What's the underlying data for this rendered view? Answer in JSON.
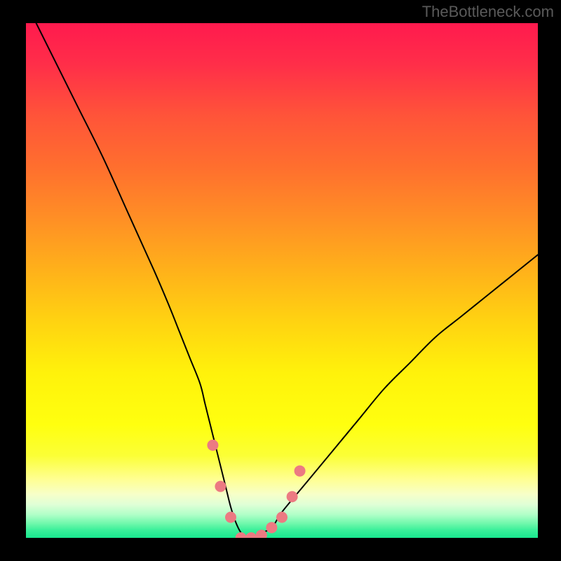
{
  "watermark": "TheBottleneck.com",
  "chart_data": {
    "type": "line",
    "title": "",
    "xlabel": "",
    "ylabel": "",
    "xlim": [
      0,
      100
    ],
    "ylim": [
      0,
      100
    ],
    "grid": false,
    "series": [
      {
        "name": "bottleneck-curve",
        "x": [
          2,
          5,
          10,
          15,
          20,
          25,
          28,
          30,
          32,
          34,
          35,
          36,
          37,
          38,
          39,
          40,
          41,
          42,
          43,
          44,
          45,
          48,
          50,
          55,
          60,
          65,
          70,
          75,
          80,
          85,
          90,
          95,
          100
        ],
        "values": [
          100,
          94,
          84,
          74,
          63,
          52,
          45,
          40,
          35,
          30,
          26,
          22,
          18,
          14,
          10,
          6,
          3,
          1,
          0,
          0,
          0.5,
          2,
          5,
          11,
          17,
          23,
          29,
          34,
          39,
          43,
          47,
          51,
          55
        ]
      }
    ],
    "markers": {
      "name": "highlight-dots",
      "color": "#ec7a82",
      "x": [
        36.5,
        38,
        40,
        42,
        44,
        46,
        48,
        50,
        52,
        53.5
      ],
      "values": [
        18,
        10,
        4,
        0,
        0,
        0.5,
        2,
        4,
        8,
        13
      ]
    },
    "background_gradient": {
      "type": "vertical",
      "stops": [
        {
          "offset": 0.0,
          "color": "#ff1a4e"
        },
        {
          "offset": 0.08,
          "color": "#ff2e49"
        },
        {
          "offset": 0.18,
          "color": "#ff5439"
        },
        {
          "offset": 0.28,
          "color": "#ff6f2e"
        },
        {
          "offset": 0.38,
          "color": "#ff8f25"
        },
        {
          "offset": 0.48,
          "color": "#ffb11a"
        },
        {
          "offset": 0.58,
          "color": "#ffd311"
        },
        {
          "offset": 0.68,
          "color": "#fff20b"
        },
        {
          "offset": 0.78,
          "color": "#ffff0f"
        },
        {
          "offset": 0.84,
          "color": "#fbff36"
        },
        {
          "offset": 0.885,
          "color": "#ffff90"
        },
        {
          "offset": 0.915,
          "color": "#f7ffc8"
        },
        {
          "offset": 0.935,
          "color": "#e0ffd6"
        },
        {
          "offset": 0.955,
          "color": "#b0ffc8"
        },
        {
          "offset": 0.972,
          "color": "#70f8ac"
        },
        {
          "offset": 0.985,
          "color": "#3af09a"
        },
        {
          "offset": 1.0,
          "color": "#18e88f"
        }
      ]
    }
  }
}
